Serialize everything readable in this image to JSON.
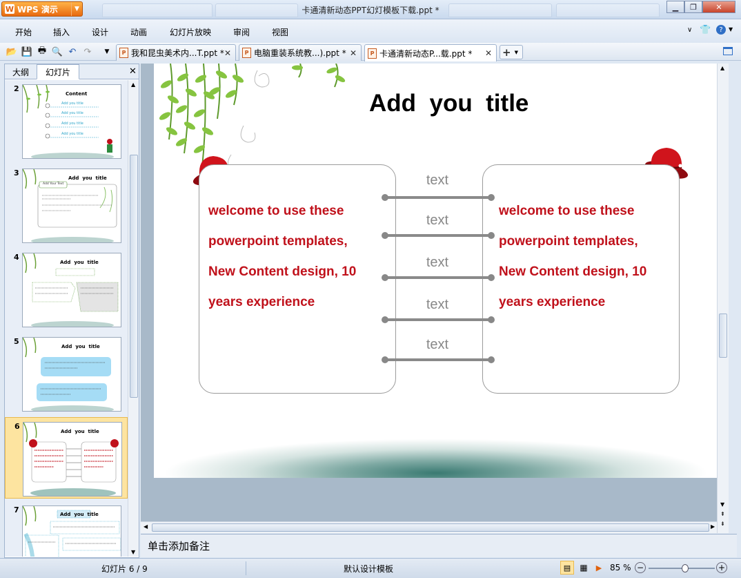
{
  "app": {
    "name": "WPS 演示",
    "logo_char": "W"
  },
  "window": {
    "title": "卡通清新动态PPT幻灯模板下载.ppt *"
  },
  "menu": [
    "开始",
    "插入",
    "设计",
    "动画",
    "幻灯片放映",
    "审阅",
    "视图"
  ],
  "doc_tabs": [
    {
      "label": "我和昆虫美术内...T.ppt *",
      "active": false
    },
    {
      "label": "电脑重装系统教...).ppt *",
      "active": false
    },
    {
      "label": "卡通清新动态P...载.ppt *",
      "active": true
    }
  ],
  "panel": {
    "tabs": [
      "大纲",
      "幻灯片"
    ],
    "active_tab": "幻灯片",
    "thumbnails": [
      {
        "num": "2",
        "title": "Content",
        "selected": false
      },
      {
        "num": "3",
        "title": "Add  you  title",
        "selected": false
      },
      {
        "num": "4",
        "title": "Add  you  title",
        "selected": false
      },
      {
        "num": "5",
        "title": "Add  you  title",
        "selected": false
      },
      {
        "num": "6",
        "title": "Add  you  title",
        "selected": true
      },
      {
        "num": "7",
        "title": "Add  you  title",
        "selected": false
      }
    ],
    "thumb_content_items": [
      "Add you title",
      "Add you title",
      "Add you title",
      "Add you title"
    ],
    "thumb3_label": "Add Your Text"
  },
  "slide": {
    "title": "Add  you  title",
    "left_text_lines": [
      "welcome to use these",
      "powerpoint templates,",
      "New Content design, 10",
      "years experience"
    ],
    "right_text_lines": [
      "welcome to use these",
      "powerpoint templates,",
      "New Content design, 10",
      "years experience"
    ],
    "connectors": [
      "text",
      "text",
      "text",
      "text",
      "text"
    ],
    "colors": {
      "body_text": "#c0111b",
      "connector": "#8a8a8a",
      "title": "#000000"
    }
  },
  "notes_placeholder": "单击添加备注",
  "status": {
    "slide_counter": "幻灯片 6 / 9",
    "template_name": "默认设计模板",
    "zoom": "85 %",
    "zoom_fraction": 0.55
  },
  "icons": [
    "open-folder-icon",
    "save-icon",
    "print-icon",
    "print-preview-icon",
    "undo-icon",
    "redo-icon",
    "dropdown-icon",
    "help-icon",
    "skin-icon",
    "new-tab-icon"
  ]
}
